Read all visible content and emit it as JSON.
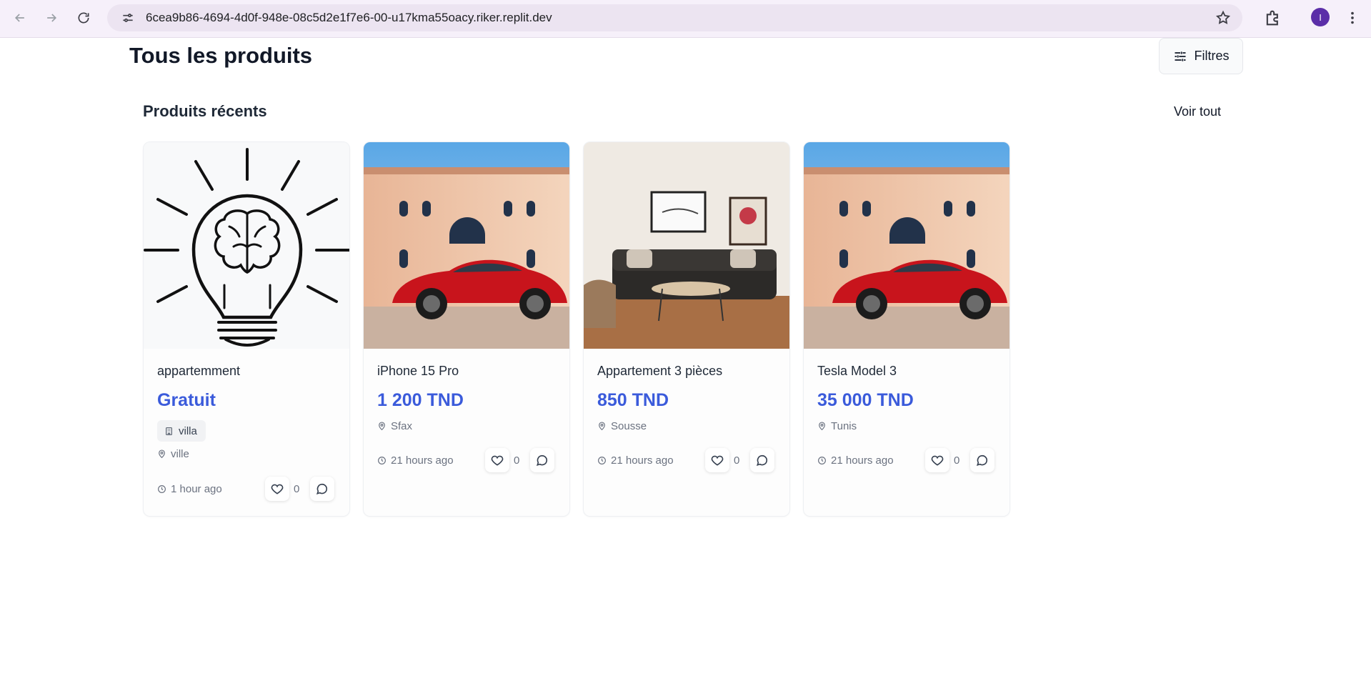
{
  "browser": {
    "url": "6cea9b86-4694-4d0f-948e-08c5d2e1f7e6-00-u17kma55oacy.riker.replit.dev",
    "profile_initial": "I"
  },
  "page": {
    "title": "Tous les produits",
    "filter_label": "Filtres",
    "section_title": "Produits récents",
    "see_all_label": "Voir tout"
  },
  "colors": {
    "price": "#3b5bdb",
    "avatar": "#5b2ea8"
  },
  "products": [
    {
      "title": "appartemment",
      "price": "Gratuit",
      "category": "villa",
      "location": "ville",
      "time": "1 hour ago",
      "likes": "0",
      "image": "lightbulb-brain-icon"
    },
    {
      "title": "iPhone 15 Pro",
      "price": "1 200 TND",
      "location": "Sfax",
      "time": "21 hours ago",
      "likes": "0",
      "image": "red-car-villa-photo"
    },
    {
      "title": "Appartement 3 pièces",
      "price": "850 TND",
      "location": "Sousse",
      "time": "21 hours ago",
      "likes": "0",
      "image": "living-room-photo"
    },
    {
      "title": "Tesla Model 3",
      "price": "35 000 TND",
      "location": "Tunis",
      "time": "21 hours ago",
      "likes": "0",
      "image": "red-car-villa-photo"
    }
  ]
}
